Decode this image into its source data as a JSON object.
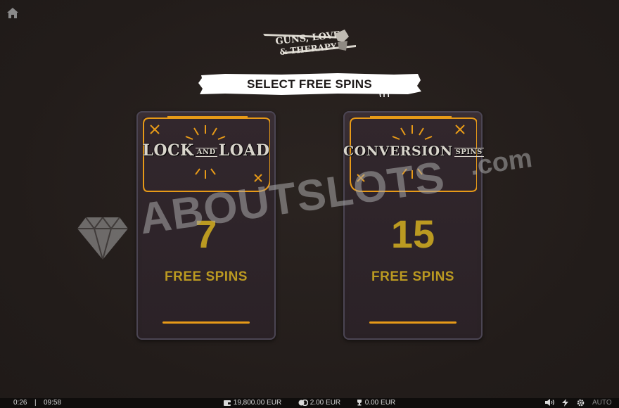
{
  "game": {
    "logo_line1": "GUNS, LOVE",
    "logo_line2": "& THERAPY"
  },
  "banner": {
    "title": "SELECT FREE SPINS"
  },
  "options": [
    {
      "name_a": "LOCK",
      "name_small": "AND",
      "name_b": "LOAD",
      "count": "7",
      "label": "FREE SPINS"
    },
    {
      "name_a": "CONVERSION",
      "name_small": "SPINS",
      "name_b": "",
      "count": "15",
      "label": "FREE SPINS"
    }
  ],
  "watermark": {
    "text": "ABOUTSLOTS",
    "domain": ".com"
  },
  "status": {
    "session_time": "0:26",
    "separator": "|",
    "clock": "09:58",
    "balance": "19,800.00 EUR",
    "bet": "2.00 EUR",
    "win": "0.00 EUR",
    "autoplay": "AUTO"
  },
  "colors": {
    "accent": "#e79a18",
    "gold_text": "#bb9a21",
    "background": "#231d1b"
  },
  "icons": [
    "home-icon",
    "wallet-icon",
    "coins-icon",
    "trophy-icon",
    "sound-icon",
    "turbo-icon",
    "settings-icon",
    "diamond-icon"
  ]
}
